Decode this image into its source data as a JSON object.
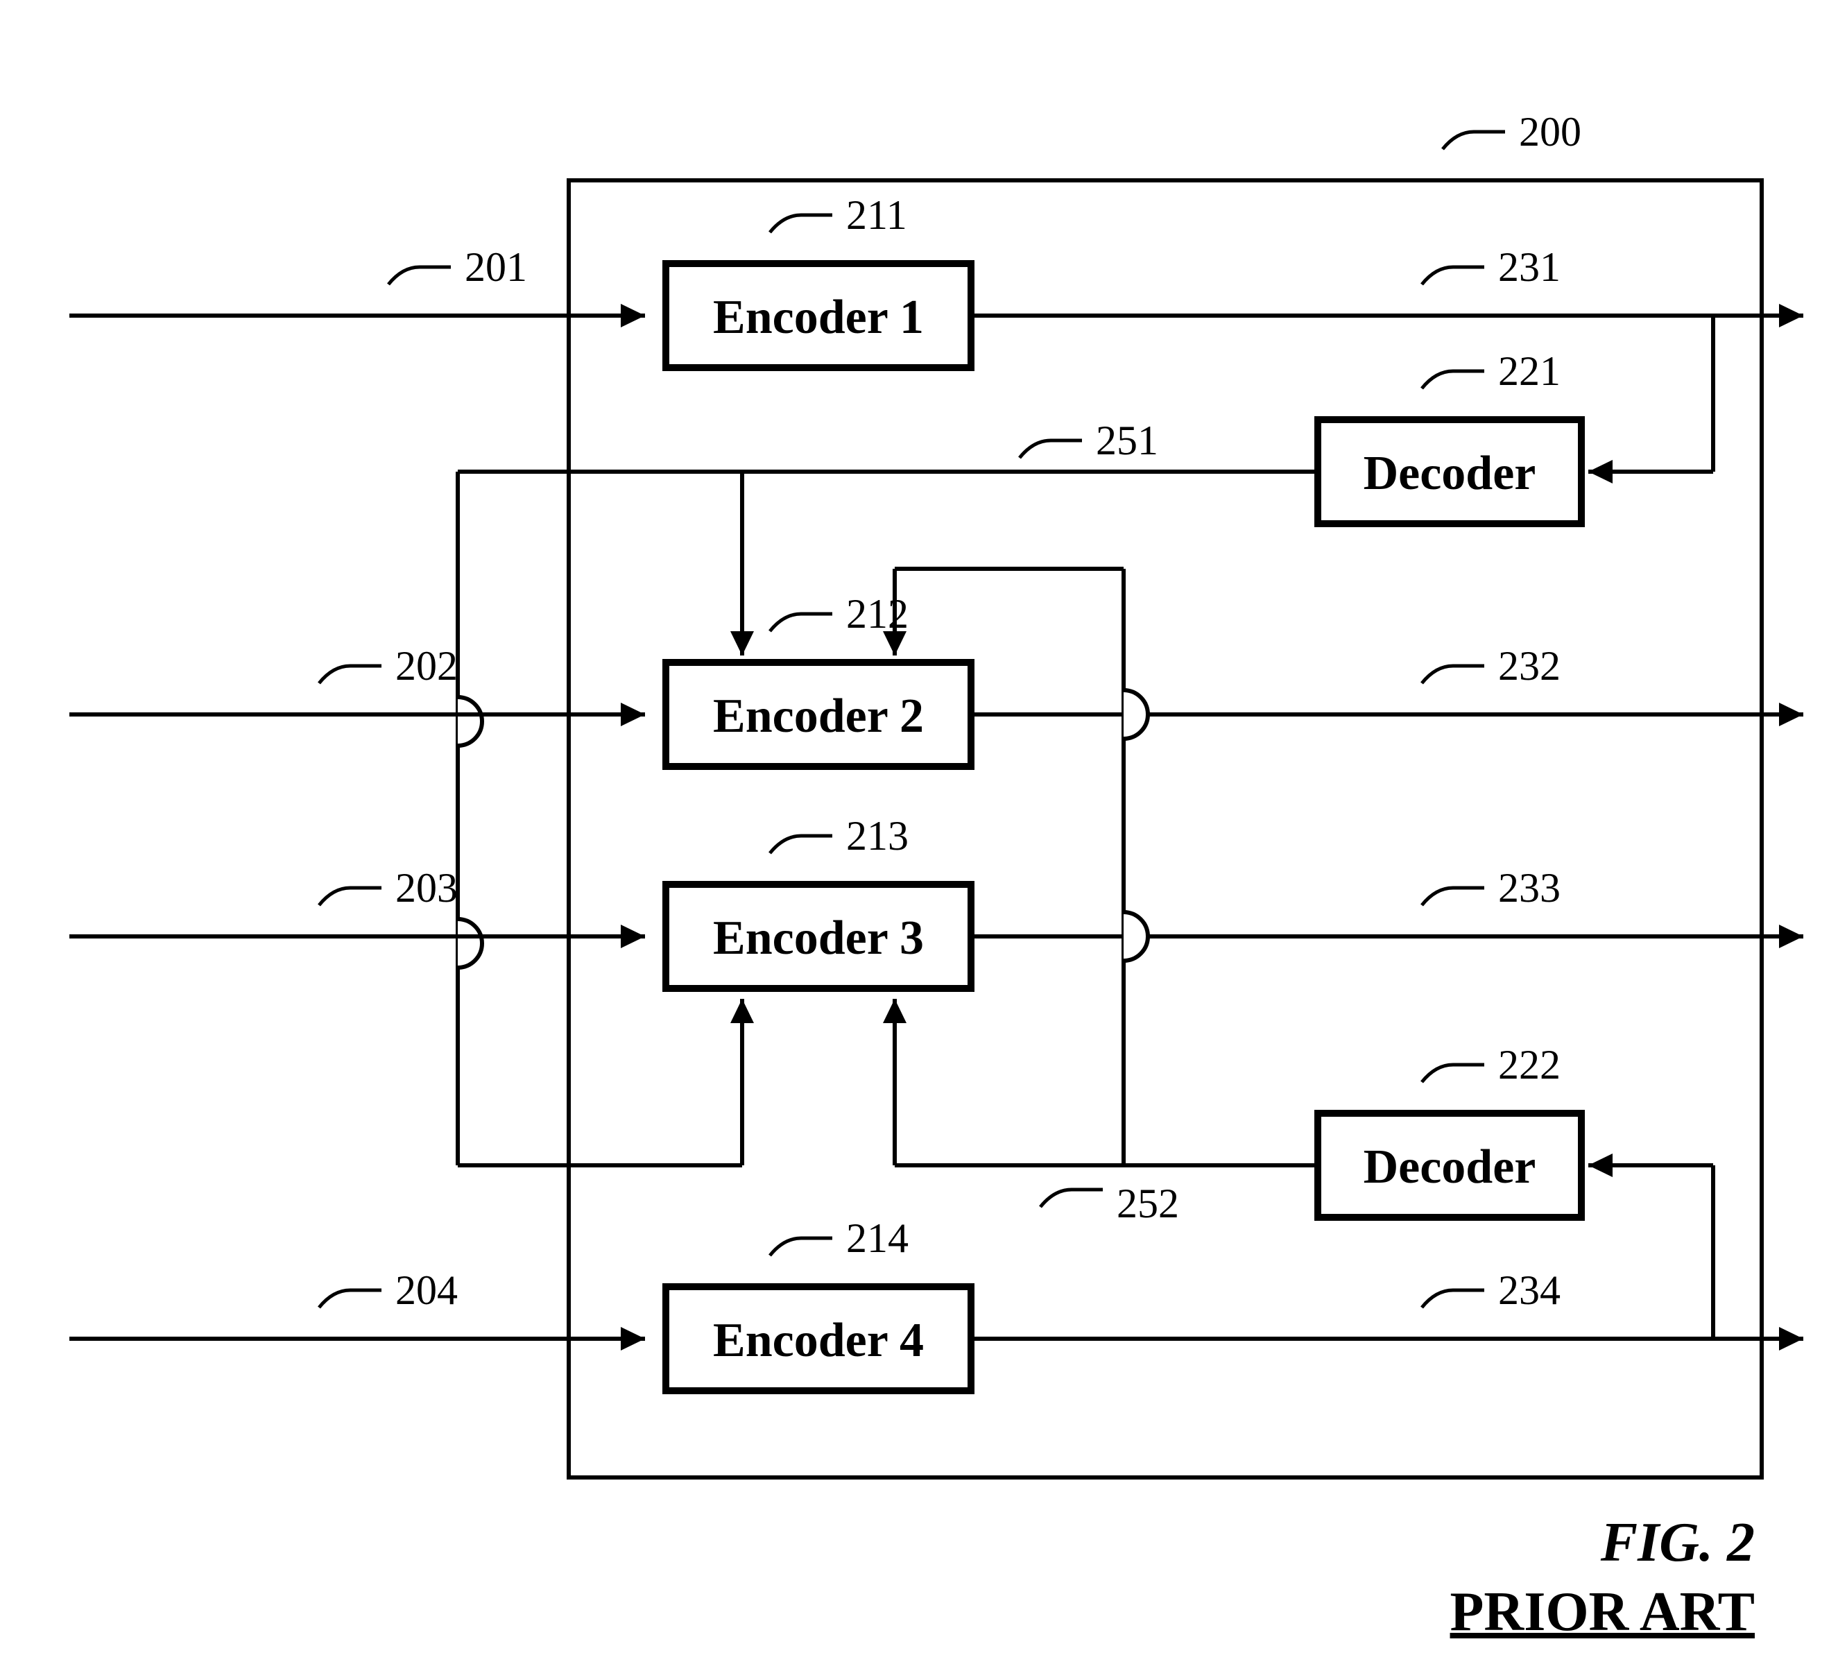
{
  "blocks": {
    "encoder1": "Encoder 1",
    "encoder2": "Encoder 2",
    "encoder3": "Encoder 3",
    "encoder4": "Encoder 4",
    "decoder1": "Decoder",
    "decoder2": "Decoder"
  },
  "refs": {
    "system": "200",
    "in1": "201",
    "in2": "202",
    "in3": "203",
    "in4": "204",
    "enc1": "211",
    "enc2": "212",
    "enc3": "213",
    "enc4": "214",
    "dec1": "221",
    "dec2": "222",
    "out1": "231",
    "out2": "232",
    "out3": "233",
    "out4": "234",
    "fb1": "251",
    "fb2": "252"
  },
  "figure": {
    "caption": "FIG. 2",
    "subtitle": "PRIOR ART"
  }
}
